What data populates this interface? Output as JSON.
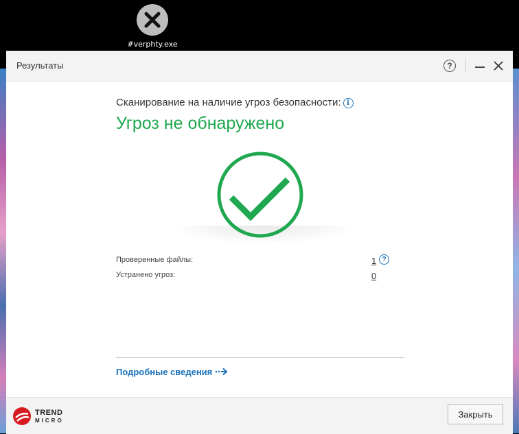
{
  "desktop": {
    "file_icon": "close-circle-icon",
    "file_label": "#verphty.exe"
  },
  "dialog": {
    "title": "Результаты",
    "help_label": "?",
    "scan_text": "Сканирование на наличие угроз безопасности:",
    "status_heading": "Угроз не обнаружено",
    "status_icon": "checkmark-icon",
    "accent_color": "#1fa84f",
    "link_color": "#1a72bb",
    "stats": [
      {
        "label": "Проверенные файлы:",
        "value": "1"
      },
      {
        "label": "Устранено угроз:",
        "value": "0"
      }
    ],
    "details_link": "Подробные сведения",
    "close_button": "Закрыть"
  },
  "brand": {
    "logo_line1": "TREND",
    "logo_line2": "MICRO",
    "logo_color": "#d71920"
  }
}
